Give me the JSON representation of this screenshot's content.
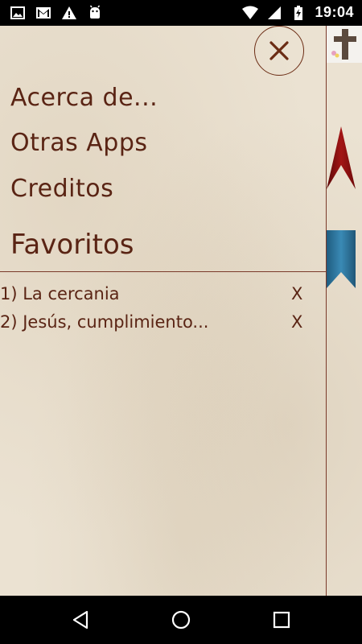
{
  "status_bar": {
    "time": "19:04",
    "left_icons": [
      "image-icon",
      "gmail-icon",
      "warning-icon",
      "android-icon"
    ],
    "right_icons": [
      "wifi-icon",
      "signal-icon",
      "battery-icon"
    ]
  },
  "drawer": {
    "close_label": "×",
    "menu": [
      {
        "label": "Acerca de..."
      },
      {
        "label": "Otras Apps"
      },
      {
        "label": "Creditos"
      }
    ],
    "favorites_title": "Favoritos",
    "favorites": [
      {
        "label": "1) La cercania",
        "remove": "X"
      },
      {
        "label": "2) Jesús, cumplimiento...",
        "remove": "X"
      }
    ]
  },
  "colors": {
    "text": "#5a2414",
    "parchment": "#ebe2d2",
    "ribbon_red": "#8b1010",
    "ribbon_blue": "#2a6f97"
  },
  "nav_bar": {
    "buttons": [
      "back-icon",
      "home-icon",
      "recents-icon"
    ]
  }
}
